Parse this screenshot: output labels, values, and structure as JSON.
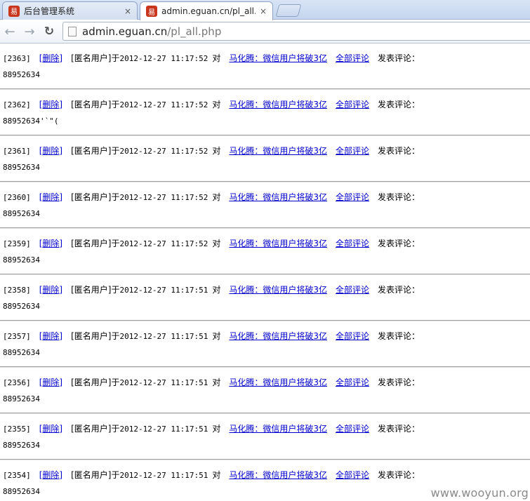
{
  "browser": {
    "tabs": [
      {
        "title": "后台管理系统",
        "active": false,
        "close": "×"
      },
      {
        "title": "admin.eguan.cn/pl_all.php",
        "active": true,
        "close": "×"
      }
    ],
    "url_host": "admin.eguan.cn",
    "url_path": "/pl_all.php"
  },
  "labels": {
    "delete": "[删除]",
    "user": "[匿名用户]",
    "at": "于",
    "to": "对",
    "article": "马化腾：微信用户将破3亿",
    "all_comments": "全部评论",
    "posted": "发表评论："
  },
  "entries": [
    {
      "id": "[2363]",
      "time": "2012-12-27 11:17:52",
      "comment": "88952634"
    },
    {
      "id": "[2362]",
      "time": "2012-12-27 11:17:52",
      "comment": "88952634'`\"("
    },
    {
      "id": "[2361]",
      "time": "2012-12-27 11:17:52",
      "comment": "88952634"
    },
    {
      "id": "[2360]",
      "time": "2012-12-27 11:17:52",
      "comment": "88952634"
    },
    {
      "id": "[2359]",
      "time": "2012-12-27 11:17:52",
      "comment": "88952634"
    },
    {
      "id": "[2358]",
      "time": "2012-12-27 11:17:51",
      "comment": "88952634"
    },
    {
      "id": "[2357]",
      "time": "2012-12-27 11:17:51",
      "comment": "88952634"
    },
    {
      "id": "[2356]",
      "time": "2012-12-27 11:17:51",
      "comment": "88952634"
    },
    {
      "id": "[2355]",
      "time": "2012-12-27 11:17:51",
      "comment": "88952634"
    },
    {
      "id": "[2354]",
      "time": "2012-12-27 11:17:51",
      "comment": "88952634"
    }
  ],
  "watermark": "www.wooyun.org"
}
